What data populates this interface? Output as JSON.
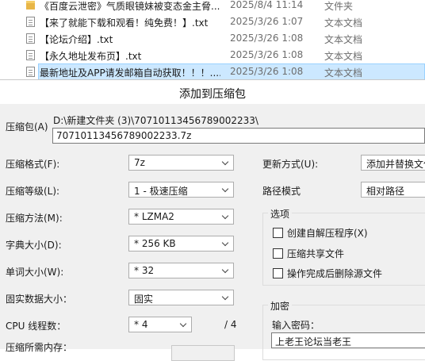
{
  "file_list": {
    "rows": [
      {
        "icon": "folder-icon",
        "name": "《百度云泄密》气质眼镜妹被变态金主脅...",
        "date": "2025/8/4 11:14",
        "type": "文件夹"
      },
      {
        "icon": "text-file-icon",
        "name": "【来了就能下载和观看！纯免费！】.txt",
        "date": "2025/3/26 1:07",
        "type": "文本文档"
      },
      {
        "icon": "text-file-icon",
        "name": "【论坛介绍】.txt",
        "date": "2025/3/26 1:08",
        "type": "文本文档"
      },
      {
        "icon": "text-file-icon",
        "name": "【永久地址发布页】.txt",
        "date": "2025/3/26 1:08",
        "type": "文本文档"
      },
      {
        "icon": "text-file-icon",
        "name": "最新地址及APP请发邮箱自动获取！！！....",
        "date": "2025/3/26 1:08",
        "type": "文本文档",
        "selected": true
      }
    ]
  },
  "dialog": {
    "title": "添加到压缩包",
    "archive": {
      "label": "压缩包(A)",
      "path": "D:\\新建文件夹 (3)\\70710113456789002233\\",
      "name": "70710113456789002233.7z"
    },
    "left_fields": {
      "format": {
        "label": "压缩格式(F):",
        "value": "7z"
      },
      "level": {
        "label": "压缩等级(L):",
        "value": "1 - 极速压缩"
      },
      "method": {
        "label": "压缩方法(M):",
        "value": "* LZMA2"
      },
      "dict": {
        "label": "字典大小(D):",
        "value": "* 256 KB"
      },
      "word": {
        "label": "单词大小(W):",
        "value": "* 32"
      },
      "solid": {
        "label": "固实数据大小：",
        "value": "固实"
      },
      "threads": {
        "label": "CPU 线程数：",
        "value": "* 4",
        "suffix": "/ 4"
      },
      "memory": {
        "label": "压缩所需内存："
      }
    },
    "right_fields": {
      "update": {
        "label": "更新方式(U):",
        "value": "添加并替换文件"
      },
      "path_mode": {
        "label": "路径模式",
        "value": "相对路径"
      }
    },
    "options": {
      "title": "选项",
      "items": [
        {
          "label": "创建自解压程序(X)",
          "checked": false
        },
        {
          "label": "压缩共享文件",
          "checked": false
        },
        {
          "label": "操作完成后删除源文件",
          "checked": false
        }
      ]
    },
    "encryption": {
      "title": "加密",
      "password_label": "输入密码：",
      "password_value": "上老王论坛当老王"
    }
  }
}
